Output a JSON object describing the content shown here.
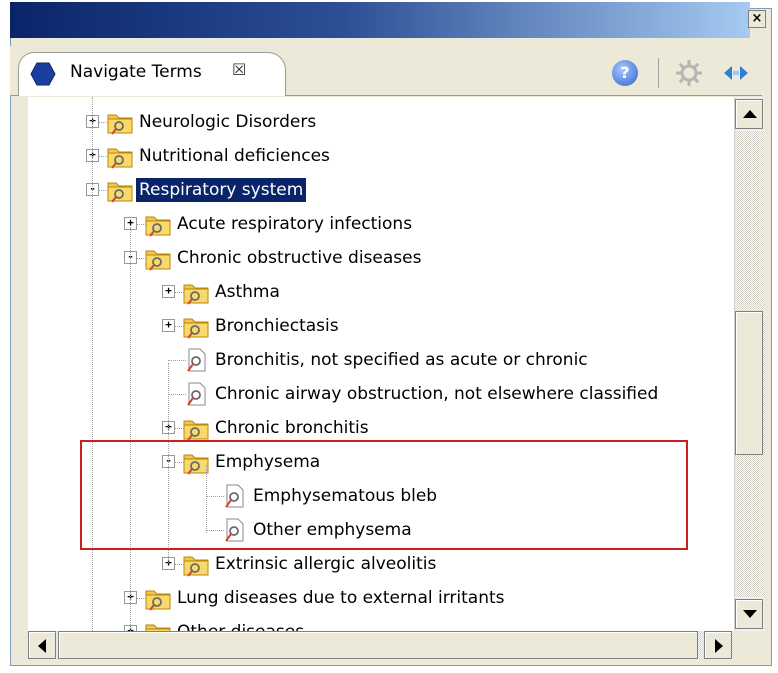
{
  "tab": {
    "title": "Navigate Terms",
    "close_glyph": "☒",
    "icon": "navigator-hexagon-icon"
  },
  "toolbar": {
    "help_glyph": "?",
    "window_close_glyph": "×"
  },
  "tree": [
    {
      "label": "Neurologic Disorders",
      "level": 0,
      "expander": "+",
      "icon": "folder-term-icon",
      "selected": false
    },
    {
      "label": "Nutritional deficiences",
      "level": 0,
      "expander": "+",
      "icon": "folder-term-icon",
      "selected": false
    },
    {
      "label": "Respiratory system",
      "level": 0,
      "expander": "-",
      "icon": "folder-term-icon",
      "selected": true
    },
    {
      "label": "Acute respiratory infections",
      "level": 1,
      "expander": "+",
      "icon": "folder-term-icon",
      "selected": false
    },
    {
      "label": "Chronic obstructive diseases",
      "level": 1,
      "expander": "-",
      "icon": "folder-term-icon",
      "selected": false
    },
    {
      "label": "Asthma",
      "level": 2,
      "expander": "+",
      "icon": "folder-term-icon",
      "selected": false
    },
    {
      "label": "Bronchiectasis",
      "level": 2,
      "expander": "+",
      "icon": "folder-term-icon",
      "selected": false
    },
    {
      "label": "Bronchitis, not specified as acute or chronic",
      "level": 2,
      "expander": "",
      "icon": "document-term-icon",
      "selected": false
    },
    {
      "label": "Chronic airway obstruction, not elsewhere classified",
      "level": 2,
      "expander": "",
      "icon": "document-term-icon",
      "selected": false
    },
    {
      "label": "Chronic bronchitis",
      "level": 2,
      "expander": "+",
      "icon": "folder-term-icon",
      "selected": false
    },
    {
      "label": "Emphysema",
      "level": 2,
      "expander": "-",
      "icon": "folder-term-icon",
      "selected": false
    },
    {
      "label": "Emphysematous bleb",
      "level": 3,
      "expander": "",
      "icon": "document-term-icon",
      "selected": false
    },
    {
      "label": "Other emphysema",
      "level": 3,
      "expander": "",
      "icon": "document-term-icon",
      "selected": false
    },
    {
      "label": "Extrinsic allergic alveolitis",
      "level": 2,
      "expander": "+",
      "icon": "folder-term-icon",
      "selected": false
    },
    {
      "label": "Lung diseases due to external irritants",
      "level": 1,
      "expander": "+",
      "icon": "folder-term-icon",
      "selected": false
    },
    {
      "label": "Other diseases",
      "level": 1,
      "expander": "+",
      "icon": "folder-term-icon",
      "selected": false
    }
  ],
  "colors": {
    "selection": "#0a246a",
    "highlight_box": "#cc1f1f",
    "titlebar_start": "#0a246a",
    "titlebar_end": "#a6caf0"
  }
}
